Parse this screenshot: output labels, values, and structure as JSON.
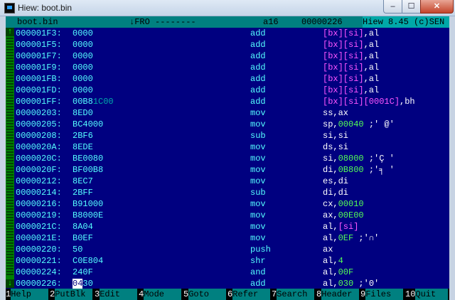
{
  "window": {
    "title": "Hiew: boot.bin",
    "min": "–",
    "max": "☐",
    "close": "✕"
  },
  "status": {
    "file": "boot.bin",
    "mode": "↓FRO --------",
    "bits": "a16",
    "offset": "00000226",
    "version": "Hiew 8.45 (c)SEN"
  },
  "rows": [
    {
      "addr": "000001F3:",
      "hex": "0000",
      "hex_dim": "",
      "mn": "add",
      "op": [
        [
          "m",
          "[bx][si]"
        ],
        [
          "w",
          ",al"
        ]
      ]
    },
    {
      "addr": "000001F5:",
      "hex": "0000",
      "hex_dim": "",
      "mn": "add",
      "op": [
        [
          "m",
          "[bx][si]"
        ],
        [
          "w",
          ",al"
        ]
      ]
    },
    {
      "addr": "000001F7:",
      "hex": "0000",
      "hex_dim": "",
      "mn": "add",
      "op": [
        [
          "m",
          "[bx][si]"
        ],
        [
          "w",
          ",al"
        ]
      ]
    },
    {
      "addr": "000001F9:",
      "hex": "0000",
      "hex_dim": "",
      "mn": "add",
      "op": [
        [
          "m",
          "[bx][si]"
        ],
        [
          "w",
          ",al"
        ]
      ]
    },
    {
      "addr": "000001FB:",
      "hex": "0000",
      "hex_dim": "",
      "mn": "add",
      "op": [
        [
          "m",
          "[bx][si]"
        ],
        [
          "w",
          ",al"
        ]
      ]
    },
    {
      "addr": "000001FD:",
      "hex": "0000",
      "hex_dim": "",
      "mn": "add",
      "op": [
        [
          "m",
          "[bx][si]"
        ],
        [
          "w",
          ",al"
        ]
      ]
    },
    {
      "addr": "000001FF:",
      "hex": "00B8",
      "hex_dim": "1C00",
      "mn": "add",
      "op": [
        [
          "m",
          "[bx][si][0001C]"
        ],
        [
          "w",
          ",bh"
        ]
      ]
    },
    {
      "addr": "00000203:",
      "hex": "8ED0",
      "hex_dim": "",
      "mn": "mov",
      "op": [
        [
          "w",
          "ss,ax"
        ]
      ]
    },
    {
      "addr": "00000205:",
      "hex": "BC4000",
      "hex_dim": "",
      "mn": "mov",
      "op": [
        [
          "w",
          "sp,"
        ],
        [
          "g",
          "00040"
        ],
        [
          "w",
          " ;' @'"
        ]
      ]
    },
    {
      "addr": "00000208:",
      "hex": "2BF6",
      "hex_dim": "",
      "mn": "sub",
      "op": [
        [
          "w",
          "si,si"
        ]
      ]
    },
    {
      "addr": "0000020A:",
      "hex": "8EDE",
      "hex_dim": "",
      "mn": "mov",
      "op": [
        [
          "w",
          "ds,si"
        ]
      ]
    },
    {
      "addr": "0000020C:",
      "hex": "BE0080",
      "hex_dim": "",
      "mn": "mov",
      "op": [
        [
          "w",
          "si,"
        ],
        [
          "g",
          "08000"
        ],
        [
          "w",
          " ;'Ç '"
        ]
      ]
    },
    {
      "addr": "0000020F:",
      "hex": "BF00B8",
      "hex_dim": "",
      "mn": "mov",
      "op": [
        [
          "w",
          "di,"
        ],
        [
          "g",
          "0B800"
        ],
        [
          "w",
          " ;'╕ '"
        ]
      ]
    },
    {
      "addr": "00000212:",
      "hex": "8EC7",
      "hex_dim": "",
      "mn": "mov",
      "op": [
        [
          "w",
          "es,di"
        ]
      ]
    },
    {
      "addr": "00000214:",
      "hex": "2BFF",
      "hex_dim": "",
      "mn": "sub",
      "op": [
        [
          "w",
          "di,di"
        ]
      ]
    },
    {
      "addr": "00000216:",
      "hex": "B91000",
      "hex_dim": "",
      "mn": "mov",
      "op": [
        [
          "w",
          "cx,"
        ],
        [
          "g",
          "00010"
        ]
      ]
    },
    {
      "addr": "00000219:",
      "hex": "B8000E",
      "hex_dim": "",
      "mn": "mov",
      "op": [
        [
          "w",
          "ax,"
        ],
        [
          "g",
          "00E00"
        ]
      ]
    },
    {
      "addr": "0000021C:",
      "hex": "8A04",
      "hex_dim": "",
      "mn": "mov",
      "op": [
        [
          "w",
          "al,"
        ],
        [
          "m",
          "[si]"
        ]
      ]
    },
    {
      "addr": "0000021E:",
      "hex": "B0EF",
      "hex_dim": "",
      "mn": "mov",
      "op": [
        [
          "w",
          "al,"
        ],
        [
          "g",
          "0EF"
        ],
        [
          "w",
          " ;'∩'"
        ]
      ]
    },
    {
      "addr": "00000220:",
      "hex": "50",
      "hex_dim": "",
      "mn": "push",
      "op": [
        [
          "w",
          "ax"
        ]
      ]
    },
    {
      "addr": "00000221:",
      "hex": "C0E804",
      "hex_dim": "",
      "mn": "shr",
      "op": [
        [
          "w",
          "al,"
        ],
        [
          "g",
          "4"
        ]
      ]
    },
    {
      "addr": "00000224:",
      "hex": "240F",
      "hex_dim": "",
      "mn": "and",
      "op": [
        [
          "w",
          "al,"
        ],
        [
          "g",
          "00F"
        ]
      ]
    },
    {
      "addr": "00000226:",
      "hex": "0430",
      "hex_dim": "",
      "mn": "add",
      "op": [
        [
          "w",
          "al,"
        ],
        [
          "g",
          "030"
        ],
        [
          "w",
          " ;'0'"
        ]
      ],
      "cursor": "04"
    }
  ],
  "fkeys": [
    {
      "n": "1",
      "label": "Help"
    },
    {
      "n": "2",
      "label": "PutBlk"
    },
    {
      "n": "3",
      "label": "Edit"
    },
    {
      "n": "4",
      "label": "Mode"
    },
    {
      "n": "5",
      "label": "Goto"
    },
    {
      "n": "6",
      "label": "Refer"
    },
    {
      "n": "7",
      "label": "Search"
    },
    {
      "n": "8",
      "label": "Header"
    },
    {
      "n": "9",
      "label": "Files"
    },
    {
      "n": "10",
      "label": "Quit"
    }
  ],
  "scrollbar": {
    "up": "↑",
    "down": "↓"
  }
}
